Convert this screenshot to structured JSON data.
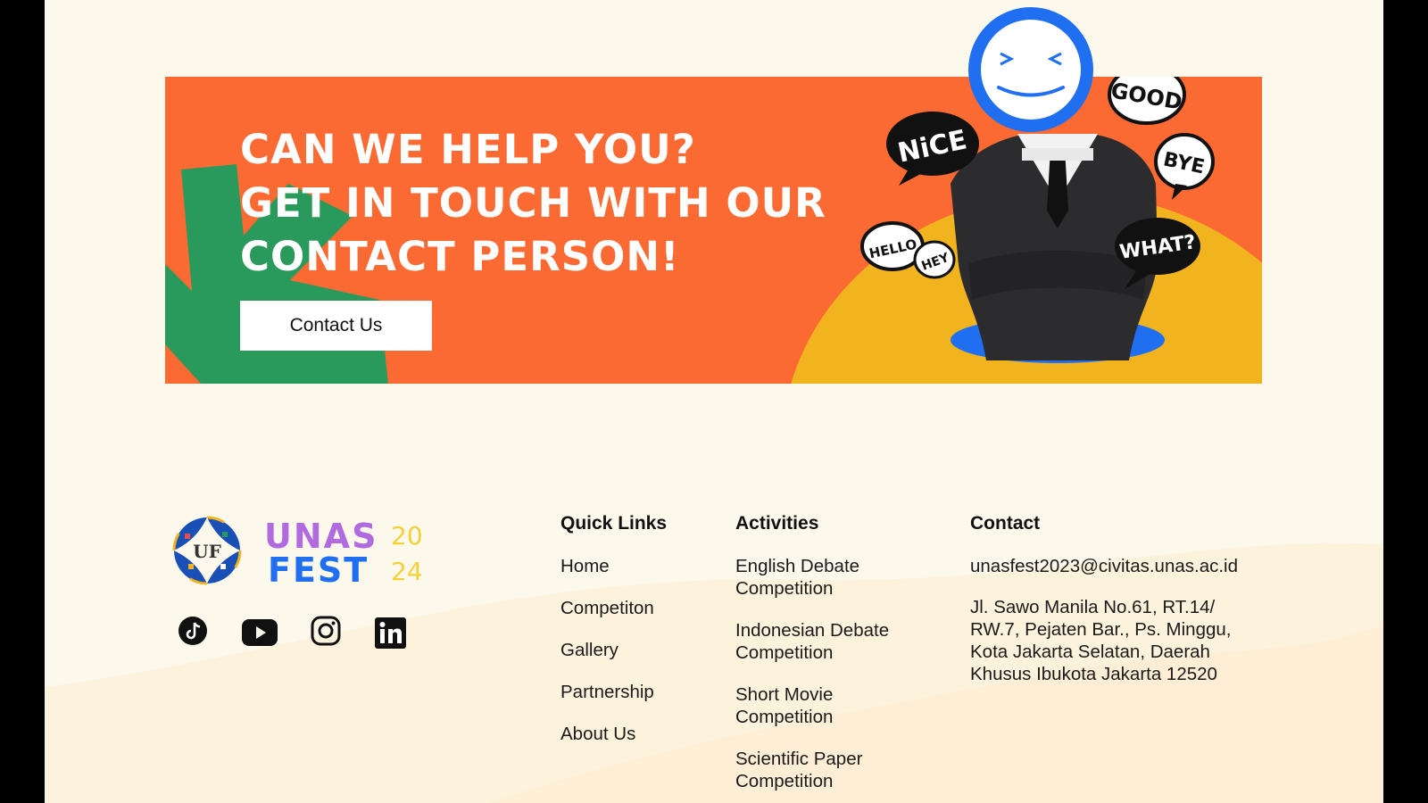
{
  "banner": {
    "headline": [
      "CAN WE HELP YOU?",
      "GET IN TOUCH WITH OUR",
      "CONTACT PERSON!"
    ],
    "button_label": "Contact Us",
    "bubbles": [
      "NiCE",
      "GOOD",
      "BYE",
      "HELLO",
      "HEY",
      "WHAT?"
    ]
  },
  "brand": {
    "uf_letters": "UF",
    "unas_row1": "UNAS",
    "unas_row2": "FEST",
    "year_top": "20",
    "year_bottom": "24"
  },
  "social": [
    {
      "icon": "tiktok-icon"
    },
    {
      "icon": "youtube-icon"
    },
    {
      "icon": "instagram-icon"
    },
    {
      "icon": "linkedin-icon"
    }
  ],
  "quick_links": {
    "title": "Quick Links",
    "items": [
      "Home",
      "Competiton",
      "Gallery",
      "Partnership",
      "About Us"
    ]
  },
  "activities": {
    "title": "Activities",
    "items": [
      "English Debate Competition",
      "Indonesian Debate Competition",
      "Short Movie Competition",
      "Scientific Paper Competition"
    ]
  },
  "contact": {
    "title": "Contact",
    "email": "unasfest2023@civitas.unas.ac.id",
    "address": "Jl. Sawo Manila No.61, RT.14/ RW.7, Pejaten Bar., Ps. Minggu, Kota Jakarta Selatan, Daerah Khusus Ibukota Jakarta 12520"
  },
  "colors": {
    "banner_bg": "#fb6a33",
    "green": "#2a9a5c",
    "yellow": "#f2b41e",
    "blue": "#1f6ff0",
    "page_bg": "#fdf8ec"
  }
}
